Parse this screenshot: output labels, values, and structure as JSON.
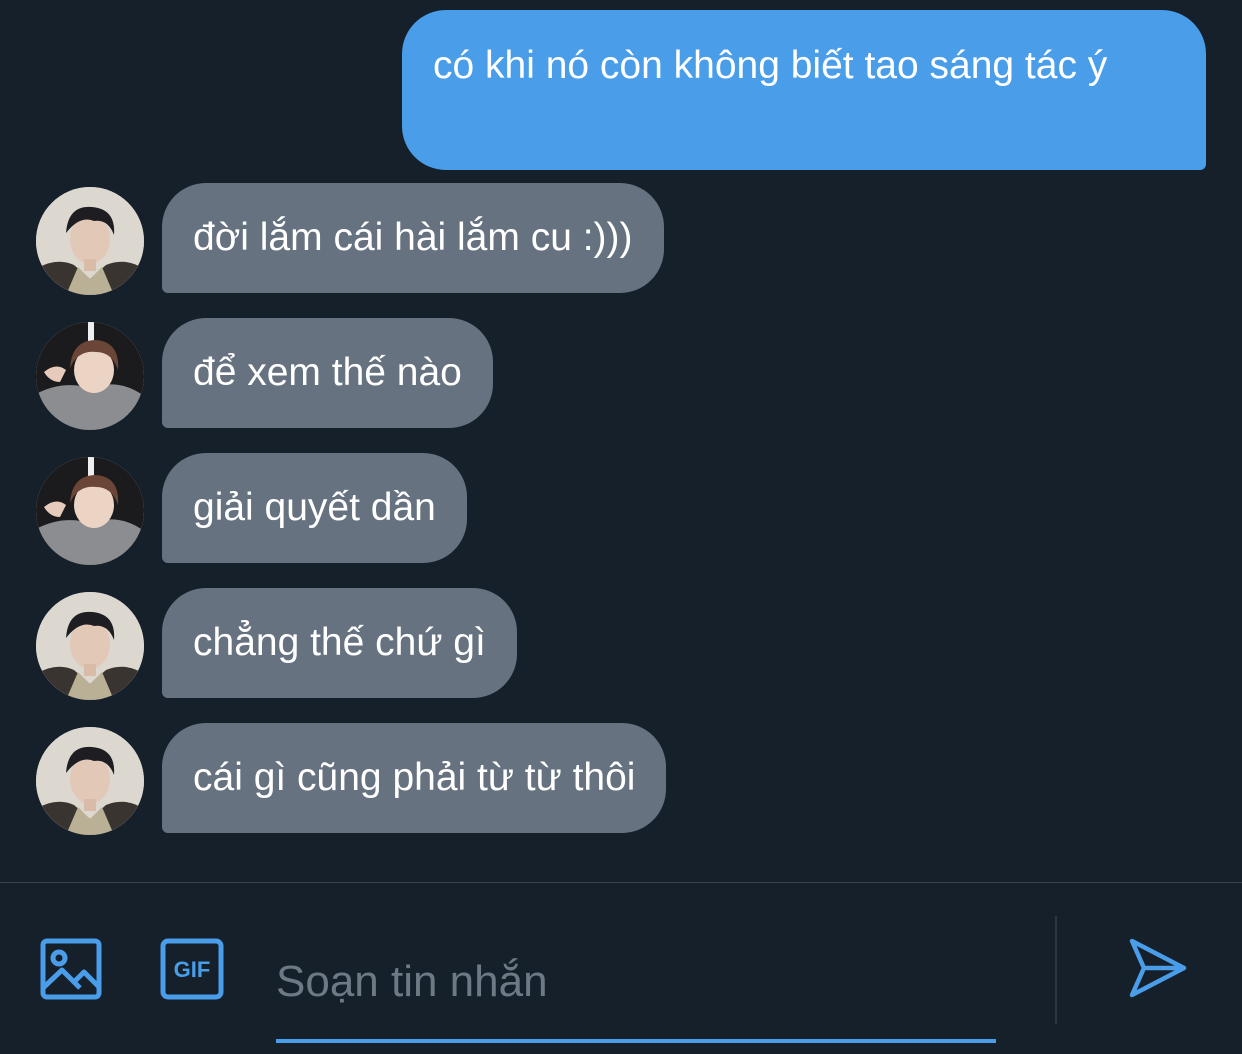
{
  "messages": {
    "outgoing": [
      {
        "text": "có khi nó còn không biết tao sáng tác ý"
      }
    ],
    "incoming": [
      {
        "text": "đời lắm cái hài lắm cu :)))",
        "avatar": "avatar-a"
      },
      {
        "text": "để xem thế nào",
        "avatar": "avatar-b"
      },
      {
        "text": "giải quyết dần",
        "avatar": "avatar-b"
      },
      {
        "text": "chẳng thế chứ gì",
        "avatar": "avatar-a"
      },
      {
        "text": "cái gì cũng phải từ từ thôi",
        "avatar": "avatar-a"
      }
    ]
  },
  "composer": {
    "placeholder": "Soạn tin nhắn",
    "value": "",
    "image_icon": "image-icon",
    "gif_icon": "gif-icon",
    "gif_label": "GIF",
    "send_icon": "send-icon"
  },
  "colors": {
    "background": "#15202b",
    "outgoing_bubble": "#4a9de9",
    "incoming_bubble": "#66727f",
    "accent": "#4a9de9",
    "placeholder": "#6d7a86"
  }
}
